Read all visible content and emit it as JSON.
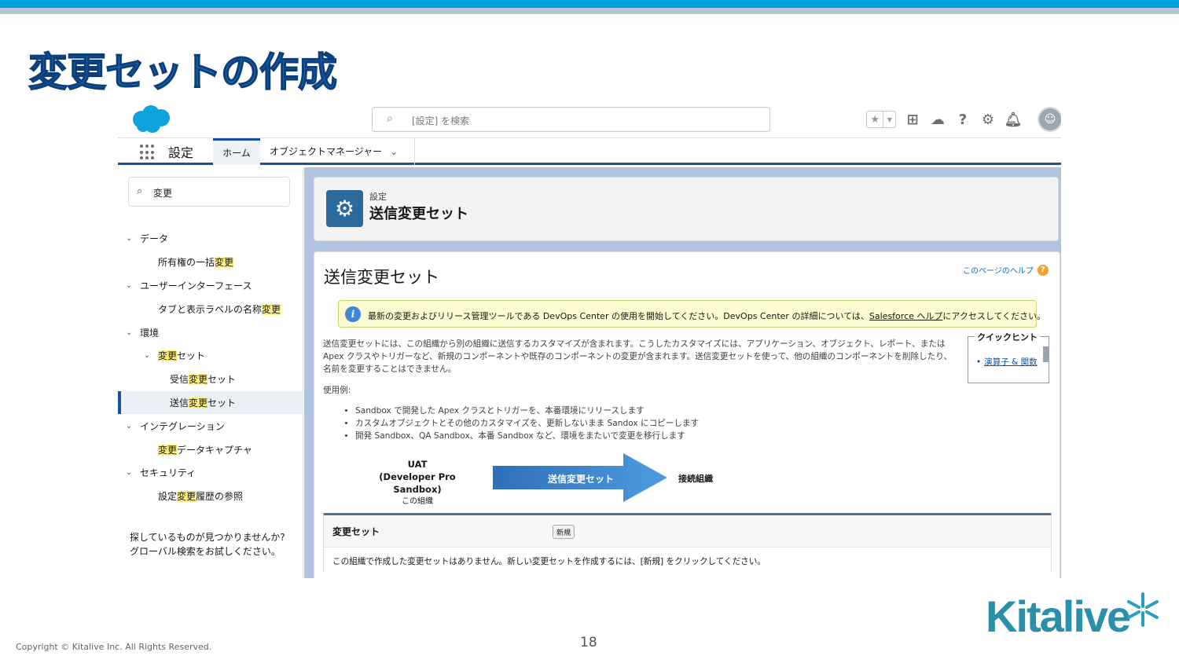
{
  "slide": {
    "title": "変更セットの作成",
    "page_number": "18",
    "copyright": "Copyright © Kitalive Inc. All Rights Reserved.",
    "brand": "Kitalive"
  },
  "header": {
    "search_placeholder": "[設定] を検索"
  },
  "nav": {
    "app_name": "設定",
    "tabs": [
      {
        "label": "ホーム"
      },
      {
        "label": "オブジェクトマネージャー"
      }
    ]
  },
  "sidebar": {
    "search_value": "変更",
    "tree": [
      {
        "label": "データ"
      },
      {
        "pre": "所有権の一括",
        "hl": "変更",
        "post": ""
      },
      {
        "label": "ユーザーインターフェース"
      },
      {
        "pre": "タブと表示ラベルの名称",
        "hl": "変更",
        "post": ""
      },
      {
        "label": "環境"
      },
      {
        "pre": "",
        "hl": "変更",
        "post": "セット"
      },
      {
        "pre": "受信",
        "hl": "変更",
        "post": "セット"
      },
      {
        "pre": "送信",
        "hl": "変更",
        "post": "セット"
      },
      {
        "label": "インテグレーション"
      },
      {
        "pre": "",
        "hl": "変更",
        "post": "データキャプチャ"
      },
      {
        "label": "セキュリティ"
      },
      {
        "pre": "設定",
        "hl": "変更",
        "post": "履歴の参照"
      }
    ],
    "footer_line1": "探しているものが見つかりませんか?",
    "footer_line2": "グローバル検索をお試しください。"
  },
  "page_header": {
    "subtitle": "設定",
    "title": "送信変更セット"
  },
  "content": {
    "title": "送信変更セット",
    "help_link": "このページのヘルプ",
    "info_pre": "最新の変更およびリリース管理ツールである DevOps Center の使用を開始してください。DevOps Center の詳細については、",
    "info_link": "Salesforce ヘルプ",
    "info_post": "にアクセスしてください。",
    "description": "送信変更セットには、この組織から別の組織に送信するカスタマイズが含まれます。こうしたカスタマイズには、アプリケーション、オブジェクト、レポート、または Apex クラスやトリガーなど、新規のコンポーネントや既存のコンポーネントの変更が含まれます。送信変更セットを使って、他の組織のコンポーネントを削除したり、名前を変更することはできません。",
    "usage_label": "使用例:",
    "usage_items": [
      "Sandbox で開発した Apex クラスとトリガーを、本番環境にリリースします",
      "カスタムオブジェクトとその他のカスタマイズを、更新しないまま Sandox にコピーします",
      "開発 Sandbox、QA Sandbox、本番 Sandbox など、環境をまたいで変更を移行します"
    ],
    "quick_hint_title": "クイックヒント",
    "quick_hint_link": "演算子 & 関数",
    "diagram": {
      "source_line1": "UAT",
      "source_line2": "(Developer Pro Sandbox)",
      "source_line3": "この組織",
      "arrow_label": "送信変更セット",
      "destination": "接続組織"
    },
    "change_sets": {
      "title": "変更セット",
      "new_button": "新規",
      "empty_message": "この組織で作成した変更セットはありません。新しい変更セットを作成するには、[新規] をクリックしてください。"
    }
  },
  "colors": {
    "accent": "#00a1e0",
    "nav_underline": "#1b5297",
    "highlight": "#fff080",
    "arrow": "#3d87d4"
  }
}
